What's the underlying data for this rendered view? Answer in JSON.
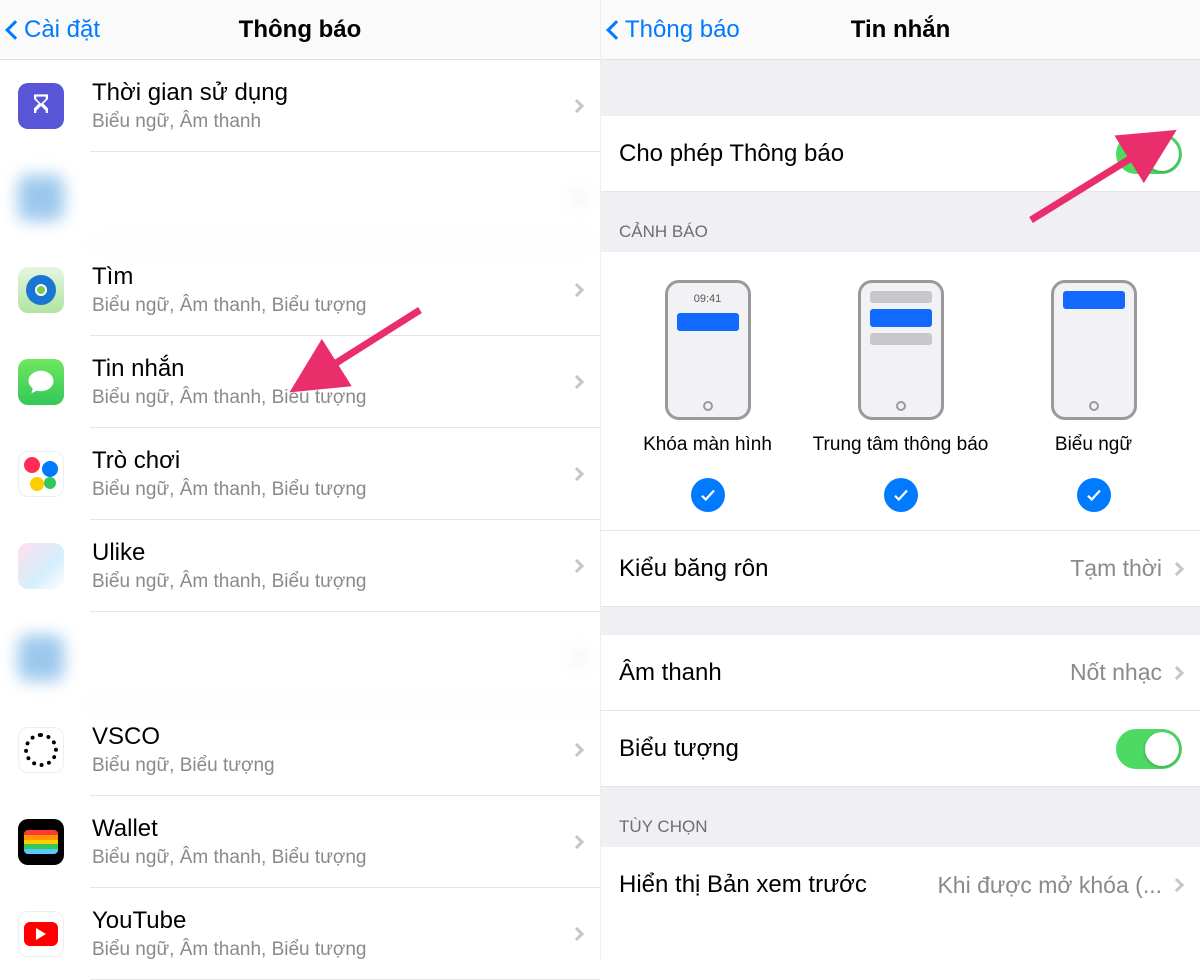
{
  "left": {
    "back_label": "Cài đặt",
    "title": "Thông báo",
    "apps": [
      {
        "name": "Thời gian sử dụng",
        "sub": "Biểu ngữ, Âm thanh",
        "icon": "hourglass"
      },
      {
        "name": "",
        "sub": "",
        "icon": "blur",
        "blurred": true
      },
      {
        "name": "Tìm",
        "sub": "Biểu ngữ, Âm thanh, Biểu tượng",
        "icon": "find"
      },
      {
        "name": "Tin nhắn",
        "sub": "Biểu ngữ, Âm thanh, Biểu tượng",
        "icon": "msg"
      },
      {
        "name": "Trò chơi",
        "sub": "Biểu ngữ, Âm thanh, Biểu tượng",
        "icon": "game"
      },
      {
        "name": "Ulike",
        "sub": "Biểu ngữ, Âm thanh, Biểu tượng",
        "icon": "ulike"
      },
      {
        "name": "",
        "sub": "",
        "icon": "blur",
        "blurred": true
      },
      {
        "name": "VSCO",
        "sub": "Biểu ngữ, Biểu tượng",
        "icon": "vsco"
      },
      {
        "name": "Wallet",
        "sub": "Biểu ngữ, Âm thanh, Biểu tượng",
        "icon": "wallet"
      },
      {
        "name": "YouTube",
        "sub": "Biểu ngữ, Âm thanh, Biểu tượng",
        "icon": "youtube"
      }
    ]
  },
  "right": {
    "back_label": "Thông báo",
    "title": "Tin nhắn",
    "allow_label": "Cho phép Thông báo",
    "alerts_header": "CẢNH BÁO",
    "alert_time": "09:41",
    "alert_types": [
      {
        "label": "Khóa màn hình"
      },
      {
        "label": "Trung tâm thông báo"
      },
      {
        "label": "Biểu ngữ"
      }
    ],
    "banner_style_label": "Kiểu băng rôn",
    "banner_style_value": "Tạm thời",
    "sound_label": "Âm thanh",
    "sound_value": "Nốt nhạc",
    "badge_label": "Biểu tượng",
    "options_header": "TÙY CHỌN",
    "preview_label": "Hiển thị Bản xem trước",
    "preview_value": "Khi được mở khóa (..."
  }
}
